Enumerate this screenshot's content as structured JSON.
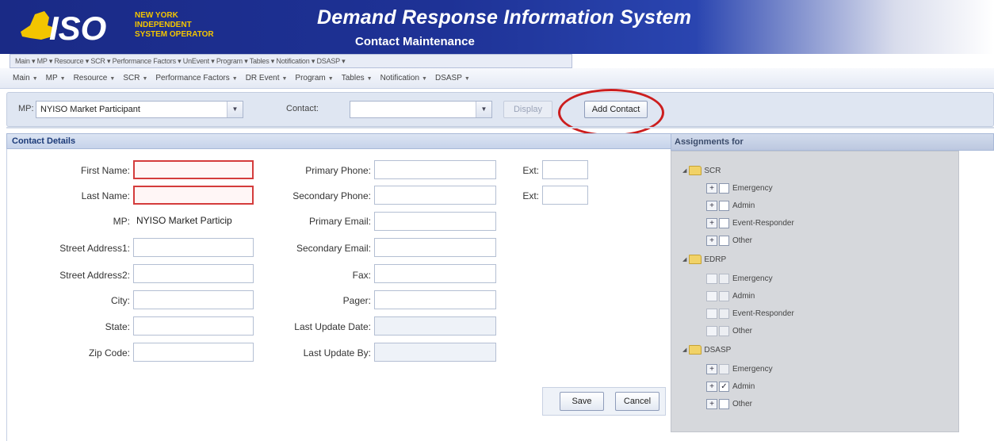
{
  "header": {
    "logo_text": "ISO",
    "logo_sub1": "NEW YORK",
    "logo_sub2": "INDEPENDENT",
    "logo_sub3": "SYSTEM OPERATOR",
    "title": "Demand Response Information System",
    "subtitle": "Contact Maintenance"
  },
  "old_menu": "Main ▾  MP ▾  Resource ▾  SCR ▾  Performance Factors ▾  UnEvent ▾  Program ▾  Tables ▾  Notification ▾  DSASP ▾",
  "menu": [
    {
      "label": "Main"
    },
    {
      "label": "MP"
    },
    {
      "label": "Resource"
    },
    {
      "label": "SCR"
    },
    {
      "label": "Performance Factors"
    },
    {
      "label": "DR Event"
    },
    {
      "label": "Program"
    },
    {
      "label": "Tables"
    },
    {
      "label": "Notification"
    },
    {
      "label": "DSASP"
    }
  ],
  "selection": {
    "mp_label": "MP:",
    "mp_value": "NYISO Market Participant",
    "contact_label": "Contact:",
    "contact_value": "",
    "display_button": "Display",
    "add_contact_button": "Add Contact"
  },
  "contact_details": {
    "title": "Contact Details",
    "first_name_label": "First Name:",
    "first_name_value": "",
    "last_name_label": "Last Name:",
    "last_name_value": "",
    "mp_label": "MP:",
    "mp_value": "NYISO Market Particip",
    "street1_label": "Street Address1:",
    "street1_value": "",
    "street2_label": "Street Address2:",
    "street2_value": "",
    "city_label": "City:",
    "city_value": "",
    "state_label": "State:",
    "state_value": "",
    "zip_label": "Zip Code:",
    "zip_value": "",
    "primary_phone_label": "Primary Phone:",
    "primary_phone_value": "",
    "secondary_phone_label": "Secondary Phone:",
    "secondary_phone_value": "",
    "primary_email_label": "Primary Email:",
    "primary_email_value": "",
    "secondary_email_label": "Secondary Email:",
    "secondary_email_value": "",
    "fax_label": "Fax:",
    "fax_value": "",
    "pager_label": "Pager:",
    "pager_value": "",
    "last_update_date_label": "Last Update Date:",
    "last_update_date_value": "",
    "last_update_by_label": "Last Update By:",
    "last_update_by_value": "",
    "ext1_label": "Ext:",
    "ext1_value": "",
    "ext2_label": "Ext:",
    "ext2_value": "",
    "save_button": "Save",
    "cancel_button": "Cancel"
  },
  "assignments": {
    "title": "Assignments for",
    "groups": [
      {
        "name": "SCR",
        "items": [
          {
            "label": "Emergency",
            "checked": false
          },
          {
            "label": "Admin",
            "checked": false
          },
          {
            "label": "Event-Responder",
            "checked": false
          },
          {
            "label": "Other",
            "checked": false
          }
        ]
      },
      {
        "name": "EDRP",
        "items": [
          {
            "label": "Emergency",
            "checked": false
          },
          {
            "label": "Admin",
            "checked": false
          },
          {
            "label": "Event-Responder",
            "checked": false
          },
          {
            "label": "Other",
            "checked": false
          }
        ]
      },
      {
        "name": "DSASP",
        "items": [
          {
            "label": "Emergency",
            "checked": false
          },
          {
            "label": "Admin",
            "checked": true
          },
          {
            "label": "Other",
            "checked": false
          }
        ]
      }
    ]
  },
  "colors": {
    "header_blue": "#1e3296",
    "required_border": "#d43c3c",
    "annotation_red": "#cc1e1e"
  }
}
